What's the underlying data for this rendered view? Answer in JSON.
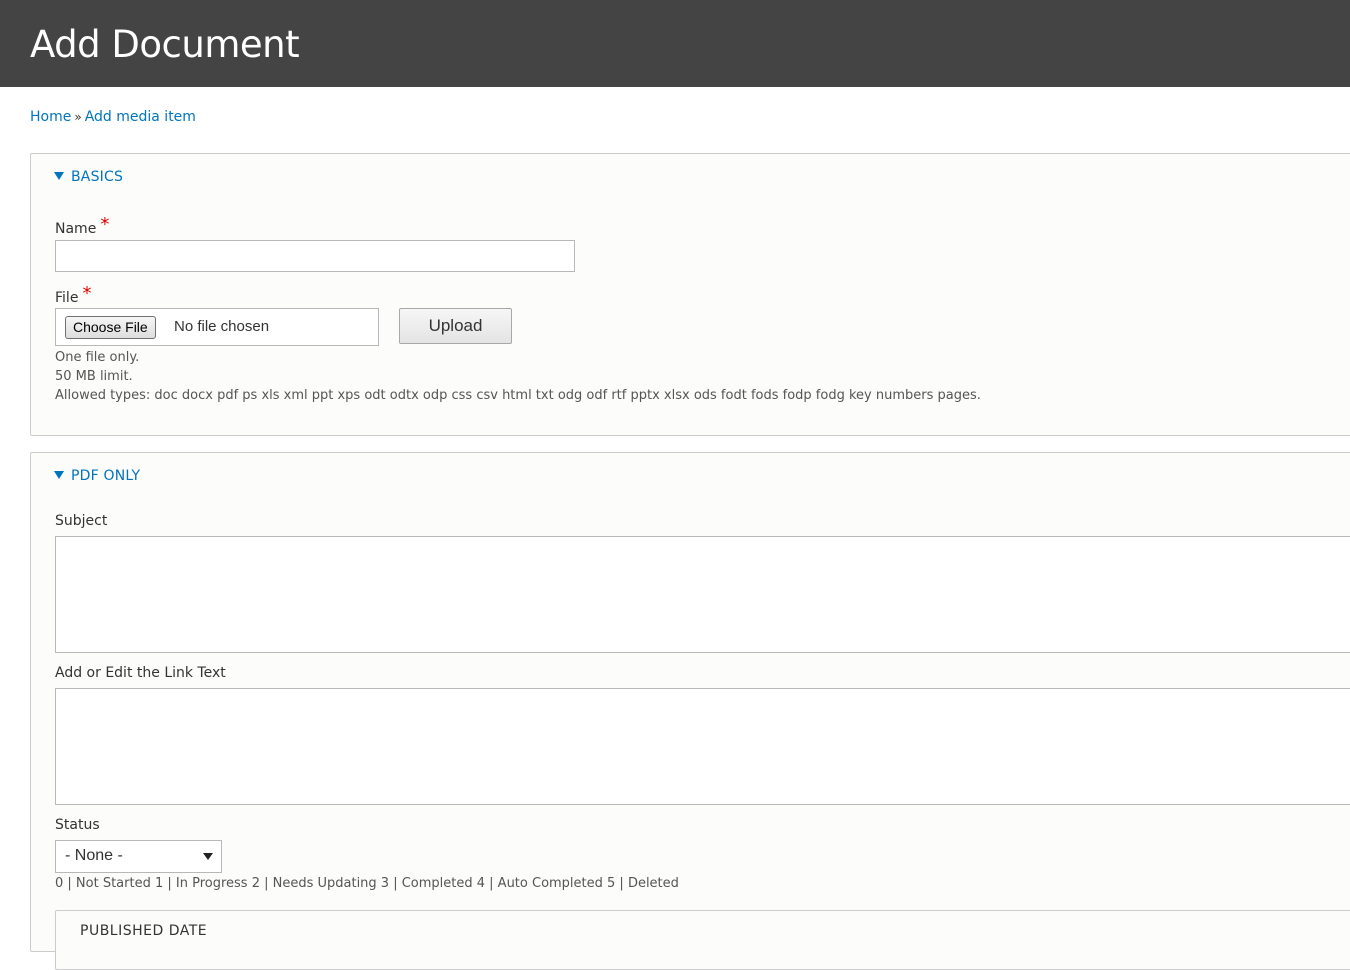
{
  "header": {
    "title": "Add Document"
  },
  "breadcrumb": {
    "home": "Home",
    "separator": "»",
    "current": "Add media item"
  },
  "basics": {
    "legend": "BASICS",
    "name_label": "Name",
    "name_required": "*",
    "name_value": "",
    "file_label": "File",
    "file_required": "*",
    "choose_file_label": "Choose File",
    "no_file_text": "No file chosen",
    "upload_label": "Upload",
    "help_one_file": "One file only.",
    "help_limit": "50 MB limit.",
    "help_types": "Allowed types: doc docx pdf ps xls xml ppt xps odt odtx odp css csv html txt odg odf rtf pptx xlsx ods fodt fods fodp fodg key numbers pages."
  },
  "pdf_only": {
    "legend": "PDF ONLY",
    "subject_label": "Subject",
    "subject_value": "",
    "link_text_label": "Add or Edit the Link Text",
    "link_text_value": "",
    "status_label": "Status",
    "status_selected": "- None -",
    "status_help": "0 | Not Started 1 | In Progress 2 | Needs Updating 3 | Completed 4 | Auto Completed 5 | Deleted",
    "published_date_legend": "PUBLISHED DATE"
  },
  "colors": {
    "header_bg": "#444444",
    "link": "#0074bd",
    "required": "#e00000"
  }
}
